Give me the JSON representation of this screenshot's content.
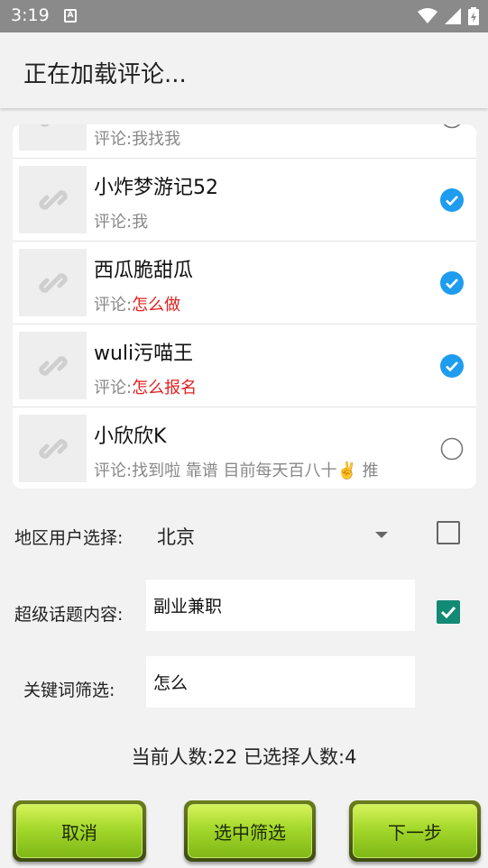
{
  "status_bar": {
    "time": "3:19",
    "notification_icon": "A"
  },
  "app_bar": {
    "title": "正在加载评论..."
  },
  "comment_prefix": "评论:",
  "list": [
    {
      "name": "",
      "comment": "我找我",
      "keyword": "",
      "checked": false,
      "partial": true
    },
    {
      "name": "小炸梦游记52",
      "comment": "我",
      "keyword": "",
      "checked": true
    },
    {
      "name": "西瓜脆甜瓜",
      "comment": "",
      "keyword": "怎么做",
      "checked": true
    },
    {
      "name": "wuli污喵王",
      "comment": "",
      "keyword": "怎么报名",
      "checked": true
    },
    {
      "name": "小欣欣K",
      "comment": "找到啦 靠谱 目前每天百八十✌️ 推",
      "keyword": "",
      "checked": false
    }
  ],
  "form": {
    "region_label": "地区用户选择:",
    "region_value": "北京",
    "region_checked": false,
    "topic_label": "超级话题内容:",
    "topic_value": "副业兼职",
    "topic_checked": true,
    "keyword_label": "关键词筛选:",
    "keyword_value": "怎么"
  },
  "counts": {
    "text": "当前人数:22 已选择人数:4"
  },
  "buttons": {
    "cancel": "取消",
    "filter": "选中筛选",
    "next": "下一步"
  },
  "colors": {
    "check_blue": "#1e9cf0",
    "checkbox_green": "#138a74",
    "keyword_red": "#e12020"
  }
}
